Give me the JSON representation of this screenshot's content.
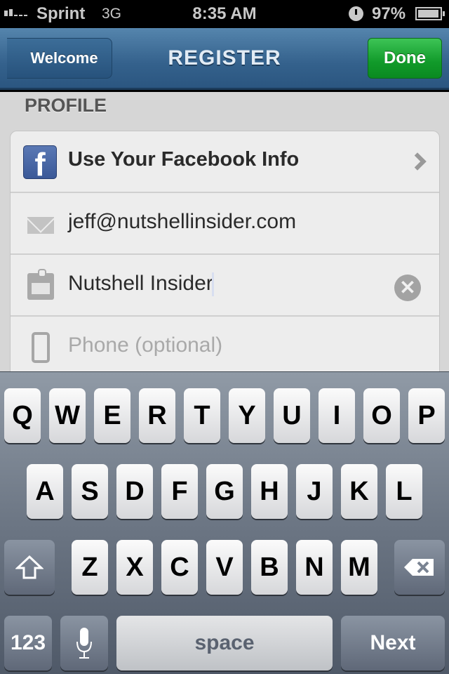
{
  "status_bar": {
    "carrier": "Sprint",
    "network": "3G",
    "time": "8:35 AM",
    "battery_percent": "97%",
    "battery_level": 0.97,
    "signal_bars": 2
  },
  "nav": {
    "back_label": "Welcome",
    "title": "REGISTER",
    "done_label": "Done"
  },
  "profile": {
    "section_title": "PROFILE",
    "facebook_label": "Use Your Facebook Info",
    "email_value": "jeff@nutshellinsider.com",
    "company_value": "Nutshell Insider",
    "phone_placeholder": "Phone (optional)"
  },
  "keyboard": {
    "row1": [
      "Q",
      "W",
      "E",
      "R",
      "T",
      "Y",
      "U",
      "I",
      "O",
      "P"
    ],
    "row2": [
      "A",
      "S",
      "D",
      "F",
      "G",
      "H",
      "J",
      "K",
      "L"
    ],
    "row3": [
      "Z",
      "X",
      "C",
      "V",
      "B",
      "N",
      "M"
    ],
    "numbers_label": "123",
    "space_label": "space",
    "next_label": "Next"
  }
}
